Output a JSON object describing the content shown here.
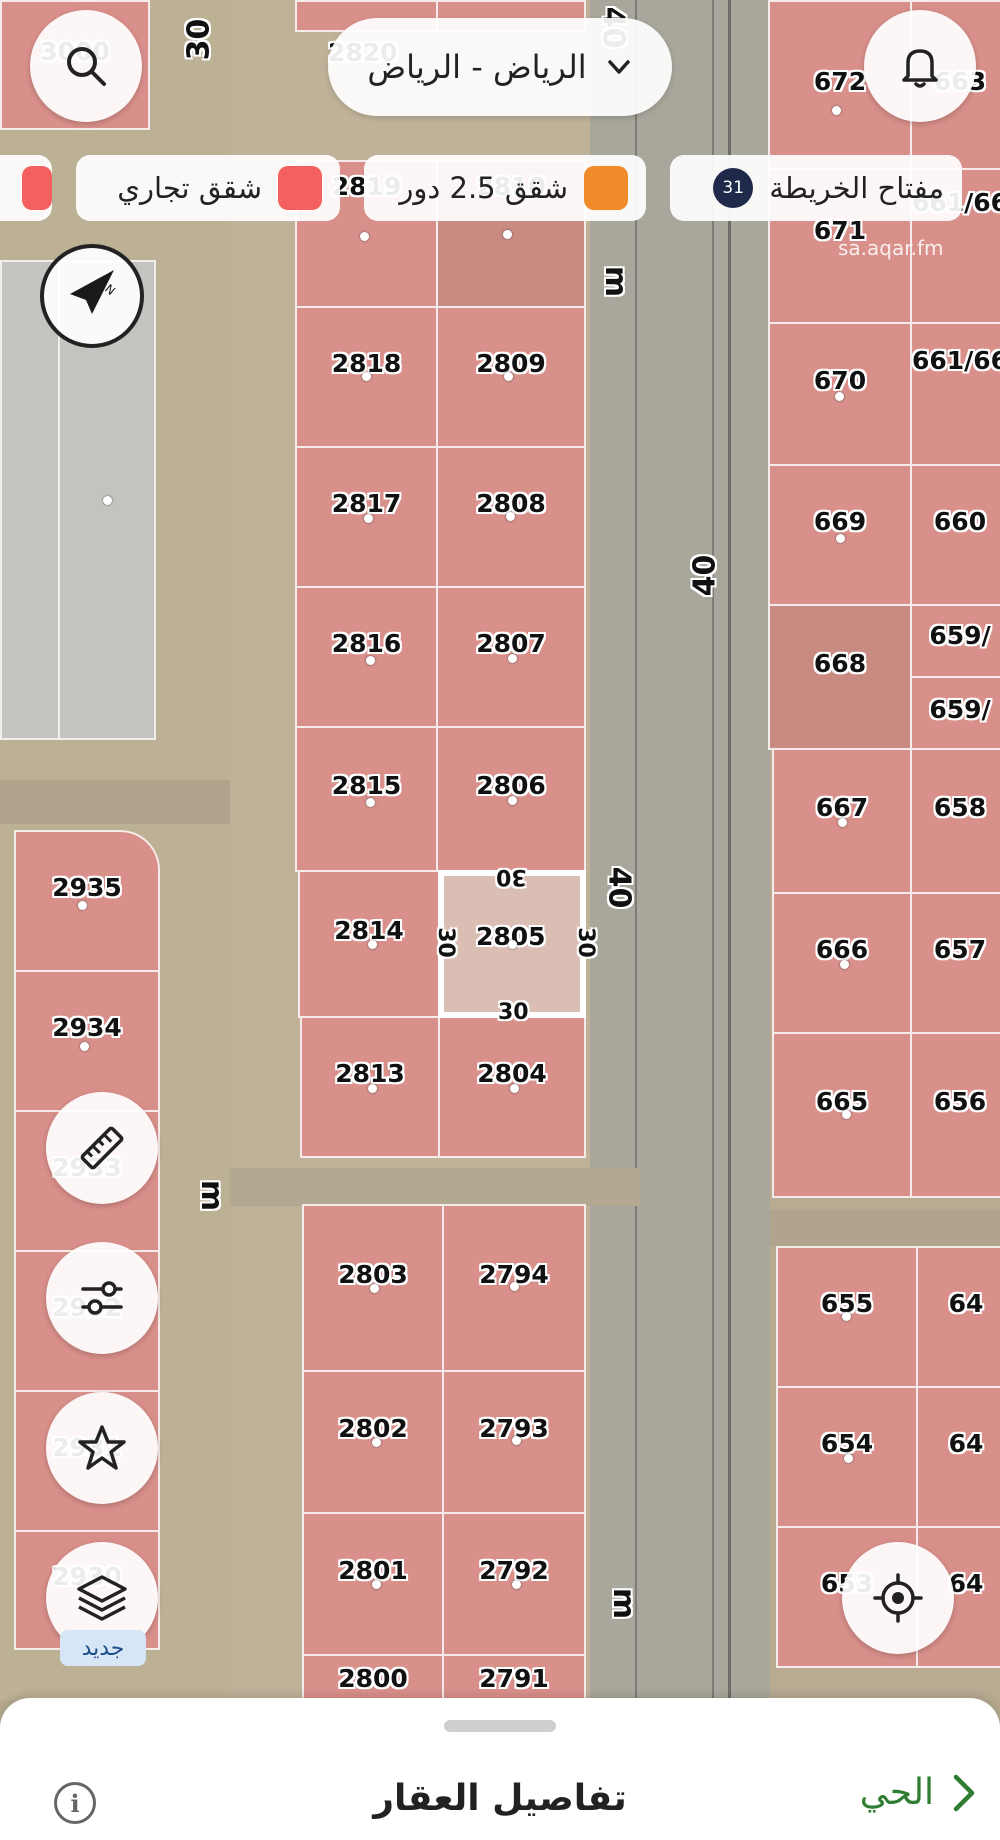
{
  "header": {
    "city": "الرياض - الرياض"
  },
  "legend": {
    "map_key": "مفتاح الخريطة",
    "map_key_count": "31",
    "items": [
      {
        "label": "شقق 2.5 دور",
        "color": "#f08a2a"
      },
      {
        "label": "شقق تجاري",
        "color": "#f26060"
      },
      {
        "label": "",
        "color": "#f26060"
      }
    ]
  },
  "map": {
    "watermark": "sa.aqar.fm",
    "street_labels": [
      "30",
      "40",
      "40",
      "40",
      "m",
      "m",
      "m"
    ],
    "plots": [
      "3000",
      "2820",
      "2819",
      "2810",
      "2818",
      "2809",
      "2817",
      "2808",
      "2816",
      "2807",
      "2815",
      "2806",
      "2814",
      "2805",
      "2813",
      "2804",
      "2803",
      "2794",
      "2802",
      "2793",
      "2801",
      "2792",
      "2800",
      "2791",
      "2935",
      "2934",
      "2933",
      "2932",
      "2931",
      "2930",
      "672",
      "663",
      "671",
      "661/66",
      "670",
      "661/66",
      "669",
      "660",
      "668",
      "659/",
      "659/",
      "667",
      "658",
      "666",
      "657",
      "665",
      "656",
      "655",
      "64",
      "654",
      "64",
      "653",
      "64"
    ],
    "selected_plot": {
      "number": "2805",
      "top": "30",
      "bottom": "30",
      "left": "30",
      "right": "30"
    }
  },
  "tools": {
    "new_label": "جديد"
  },
  "sheet": {
    "title": "تفاصيل العقار",
    "district": "الحي"
  }
}
